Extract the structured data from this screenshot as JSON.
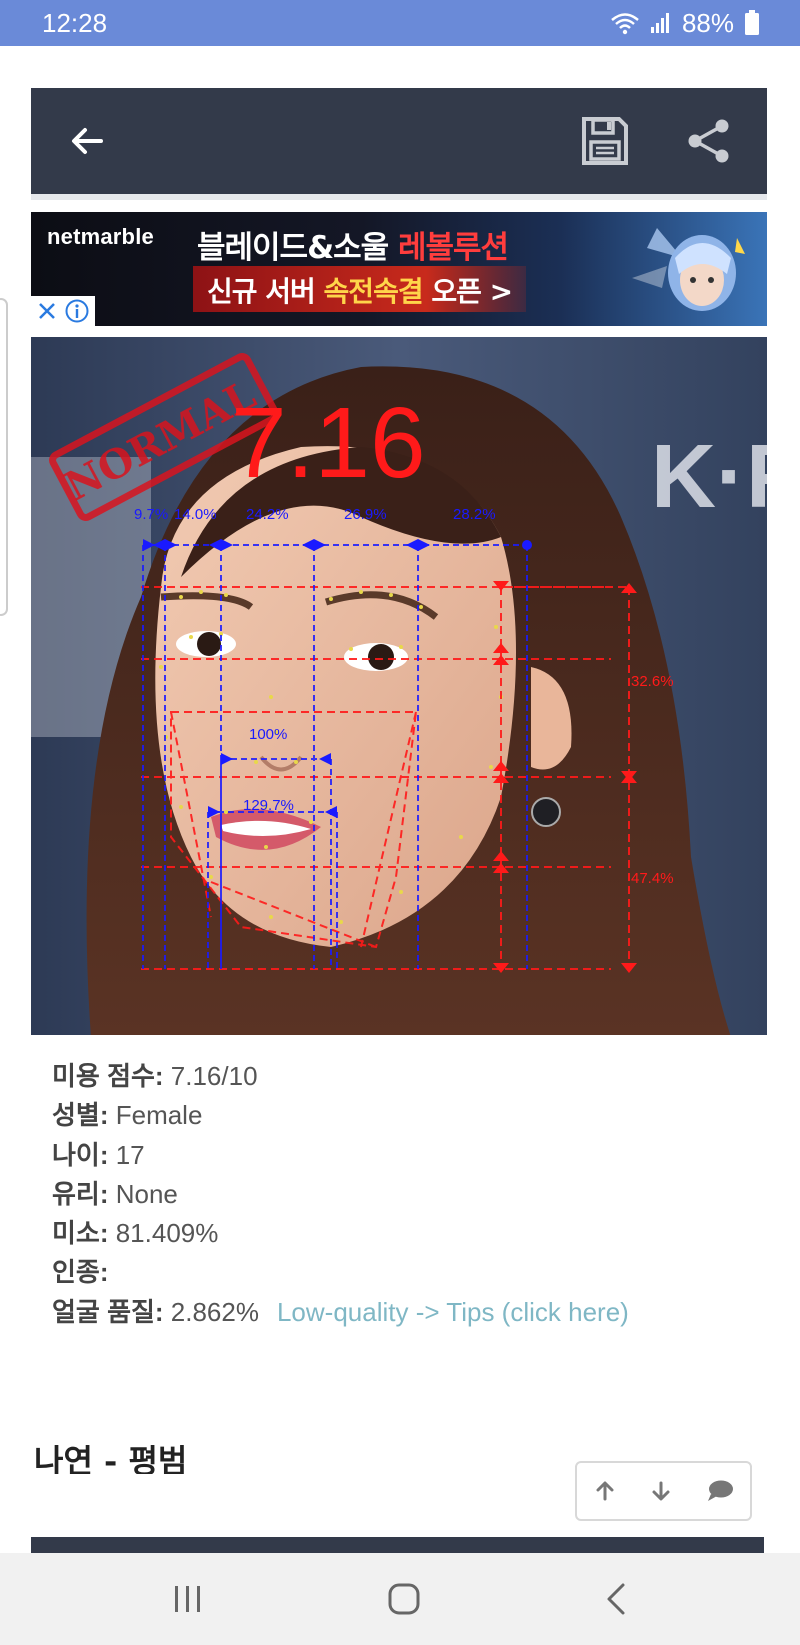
{
  "status_bar": {
    "time": "12:28",
    "battery": "88%"
  },
  "toolbar": {
    "back_icon": "arrow-left-icon",
    "save_icon": "floppy-disk-icon",
    "share_icon": "share-icon"
  },
  "ad": {
    "brand": "netmarble",
    "line1_white": "블레이드&소울 ",
    "line1_red": "레볼루션",
    "line2_white1": "신규 서버 ",
    "line2_yellow": "속전속결",
    "line2_white2": " 오픈 >",
    "close_icon": "close-icon",
    "info_icon": "info-icon"
  },
  "analysis": {
    "stamp": "NORMAL",
    "score_big": "7.16",
    "width_labels": [
      "9.7%",
      "14.0%",
      "24.2%",
      "26.9%",
      "28.2%"
    ],
    "nose_label": "100%",
    "mouth_label": "129.7%",
    "upper_label": "32.6%",
    "lower_label": "47.4%",
    "colors": {
      "red": "#ff1a1a",
      "blue": "#1a1aff",
      "dots": "#e8d84a"
    }
  },
  "info": {
    "rows": [
      {
        "label": "미용 점수:",
        "value": " 7.16/10"
      },
      {
        "label": "성별:",
        "value": " Female"
      },
      {
        "label": "나이:",
        "value": " 17"
      },
      {
        "label": "유리:",
        "value": " None"
      },
      {
        "label": "미소:",
        "value": " 81.409%"
      },
      {
        "label": "인종:",
        "value": ""
      },
      {
        "label": "얼굴 품질:",
        "value": " 2.862%"
      }
    ],
    "tips_link": "Low-quality -> Tips (click here)"
  },
  "section_title": "나연 - 평범",
  "float_nav": {
    "up_icon": "arrow-up-icon",
    "down_icon": "arrow-down-icon",
    "comment_icon": "comment-icon"
  },
  "nav_bar": {
    "recents_icon": "recents-icon",
    "home_icon": "home-icon",
    "back_icon": "back-chevron-icon"
  }
}
